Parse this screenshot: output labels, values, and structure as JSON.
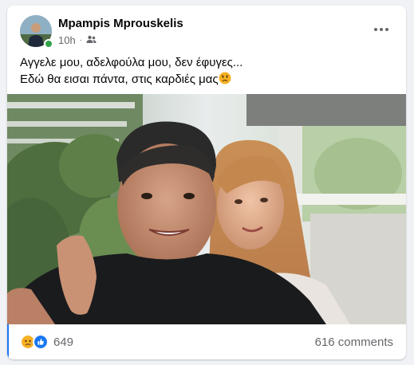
{
  "post": {
    "author": "Mpampis Mprouskelis",
    "timestamp": "10h",
    "separator": "·",
    "audience_icon": "friends-icon",
    "text_line1": "Αγγελε μου, αδελφούλα μου, δεν έφυγες...",
    "text_line2": "Εδώ θα εισαι πάντα, στις καρδιές μας",
    "text_emoji": "sad-face-emoji",
    "photo_description": "selfie-photo"
  },
  "footer": {
    "reaction_icons": [
      "sad-reaction-icon",
      "like-reaction-icon"
    ],
    "reaction_count": "649",
    "comments": "616 comments"
  },
  "colors": {
    "accent": "#1877f2",
    "online": "#31a24c",
    "secondary_text": "#65676b",
    "sad_reaction": "#f7b125",
    "like_reaction": "#1877f2"
  }
}
